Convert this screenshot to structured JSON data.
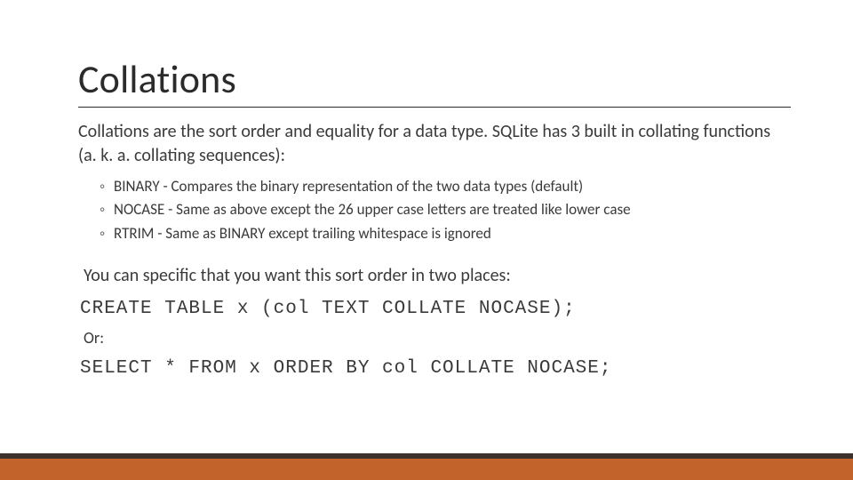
{
  "title": "Collations",
  "intro": "Collations are the sort order and equality for a data type. SQLite has 3 built in collating functions (a. k. a. collating sequences):",
  "bullets": [
    "BINARY - Compares the binary representation of the two data types (default)",
    "NOCASE - Same as above except the 26 upper case letters are treated like lower case",
    "RTRIM - Same as BINARY except trailing whitespace is ignored"
  ],
  "body_line": "You can specific that you want this sort order in two places:",
  "code1": "CREATE TABLE x (col TEXT COLLATE NOCASE);",
  "or_label": "Or:",
  "code2": "SELECT * FROM x ORDER BY col COLLATE NOCASE;",
  "colors": {
    "footer_top": "#3b322d",
    "footer_bottom": "#c1632b"
  }
}
